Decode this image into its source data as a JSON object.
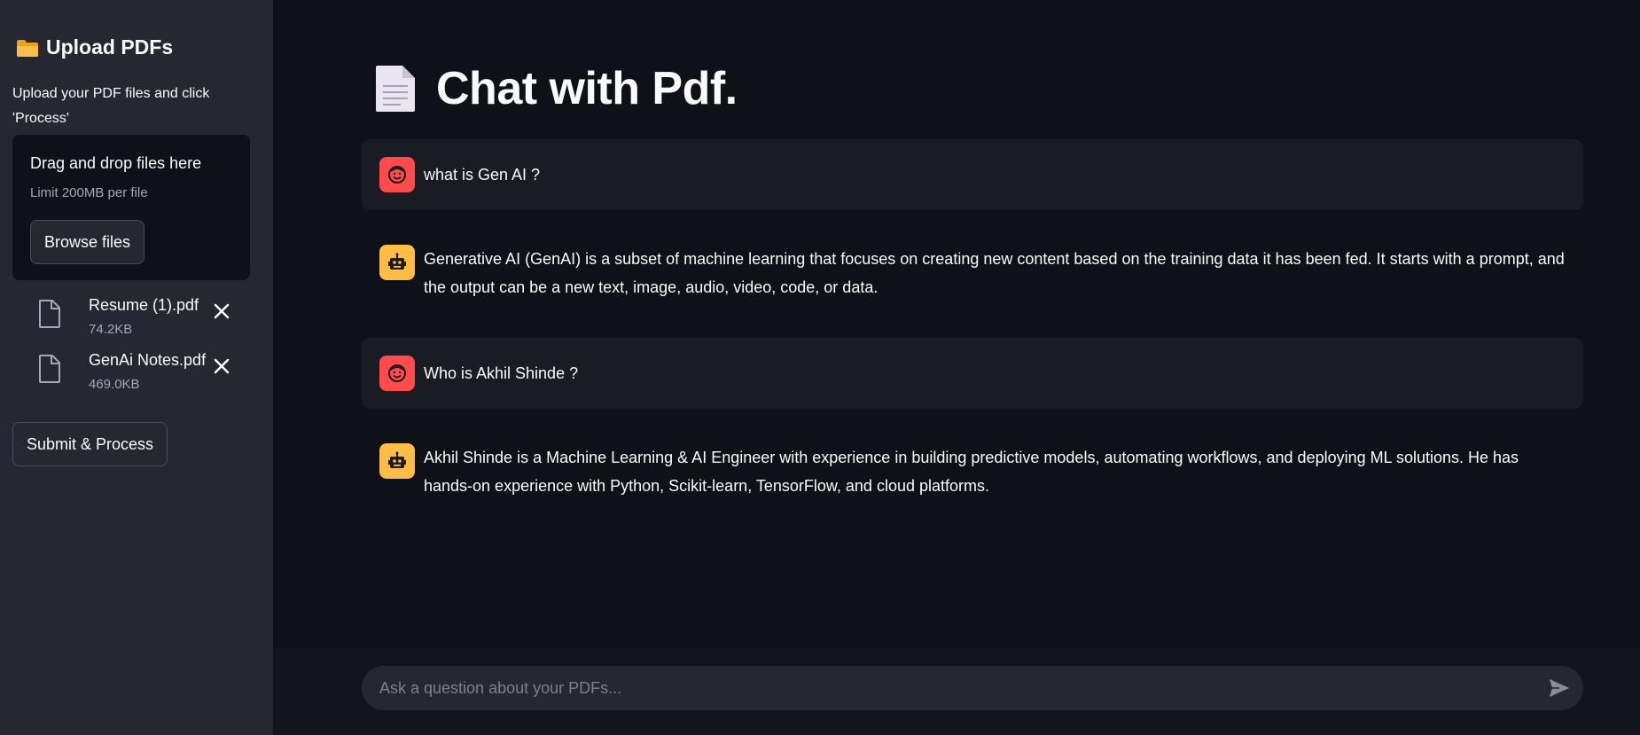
{
  "sidebar": {
    "title": "Upload PDFs",
    "description": "Upload your PDF files and click 'Process'",
    "dropzone": {
      "title": "Drag and drop files here",
      "limit": "Limit 200MB per file",
      "browse_label": "Browse files"
    },
    "files": [
      {
        "name": "Resume (1).pdf",
        "size": "74.2KB"
      },
      {
        "name": "GenAi Notes.pdf",
        "size": "469.0KB"
      }
    ],
    "submit_label": "Submit & Process"
  },
  "main": {
    "title": "Chat with Pdf."
  },
  "messages": [
    {
      "role": "user",
      "text": "what is Gen AI ?"
    },
    {
      "role": "assistant",
      "text": "Generative AI (GenAI) is a subset of machine learning that focuses on creating new content based on the training data it has been fed. It starts with a prompt, and the output can be a new text, image, audio, video, code, or data."
    },
    {
      "role": "user",
      "text": "Who is Akhil Shinde ?"
    },
    {
      "role": "assistant",
      "text": "Akhil Shinde is a Machine Learning & AI Engineer with experience in building predictive models, automating workflows, and deploying ML solutions. He has hands-on experience with Python, Scikit-learn, TensorFlow, and cloud platforms."
    }
  ],
  "chat_input": {
    "placeholder": "Ask a question about your PDFs..."
  },
  "colors": {
    "sidebar_bg": "#262730",
    "main_bg": "#0e1117",
    "user_avatar": "#ff4b4b",
    "bot_avatar": "#ffbd45"
  },
  "icons": {
    "sidebar_title": "folder-icon",
    "page_title": "document-icon",
    "file": "file-icon",
    "remove": "close-icon",
    "user_avatar": "user-face-icon",
    "bot_avatar": "robot-icon",
    "send": "send-icon"
  }
}
